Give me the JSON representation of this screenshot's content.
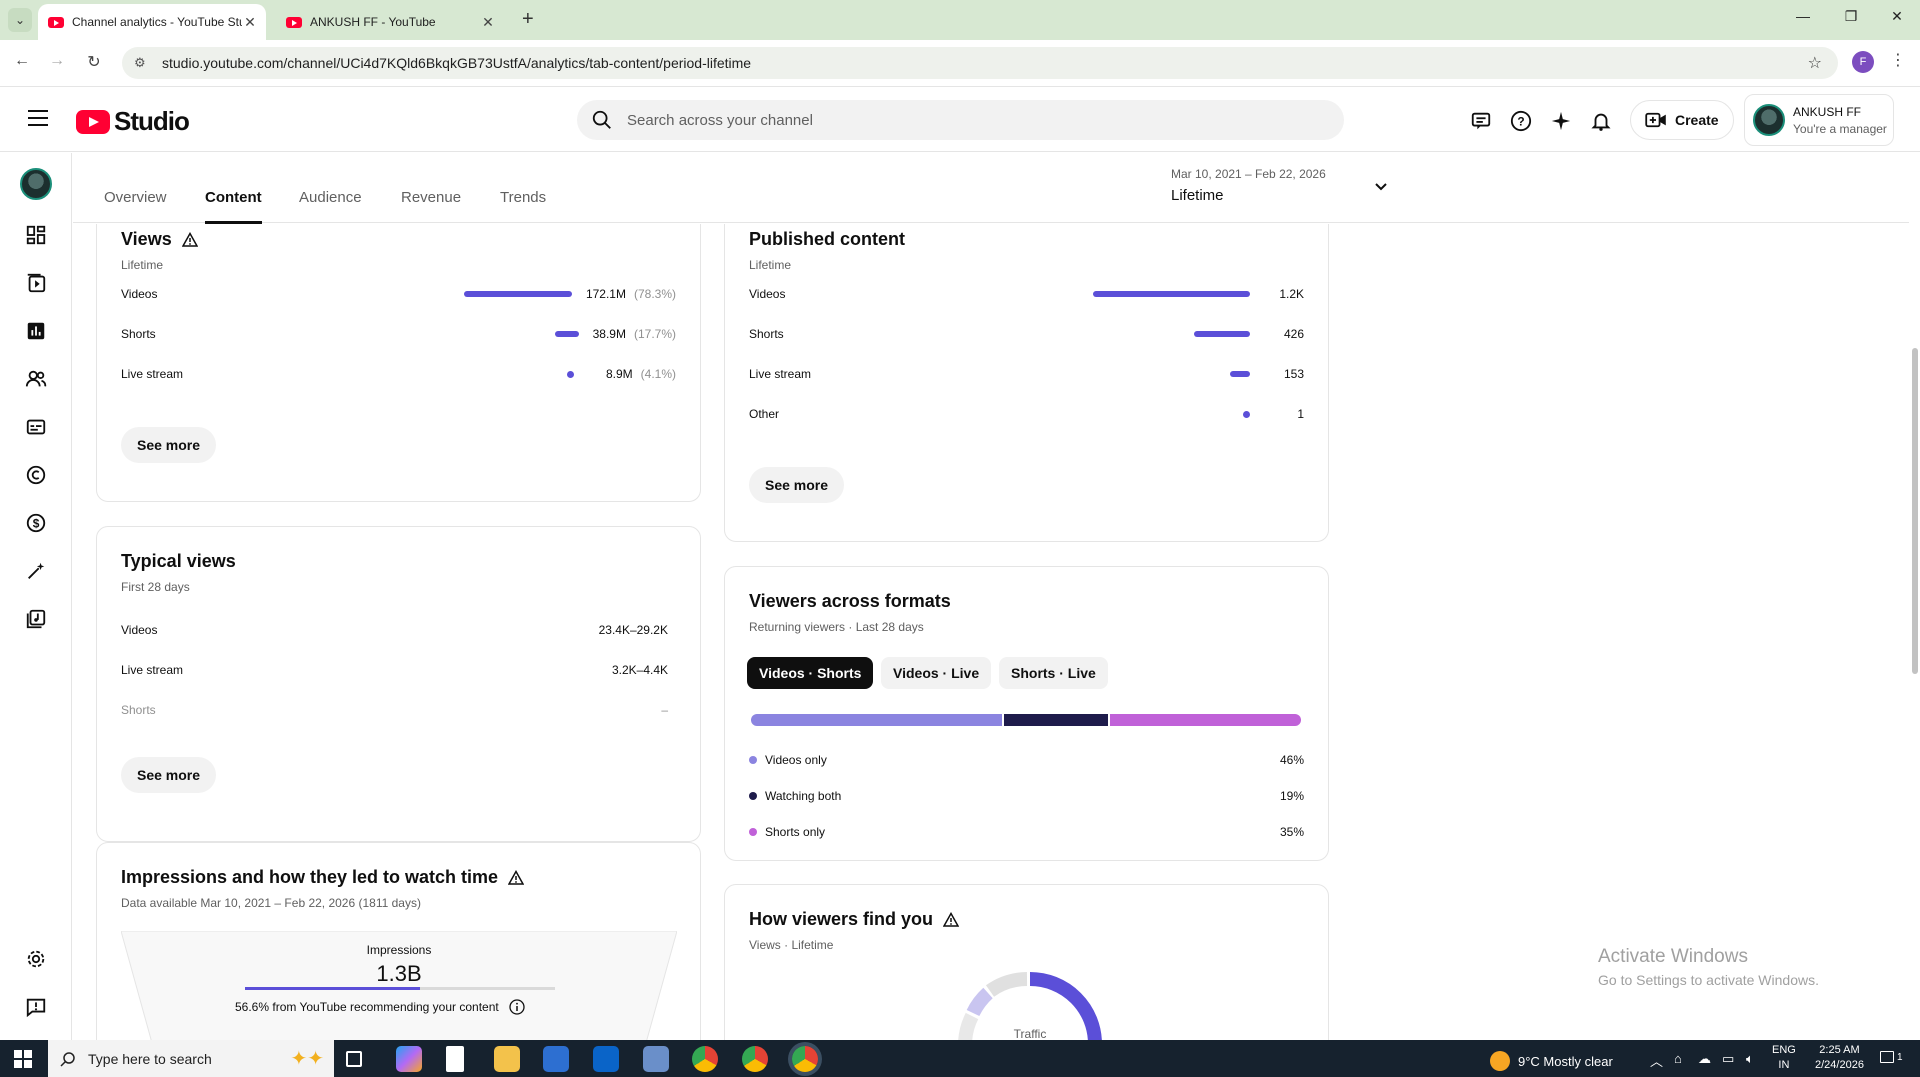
{
  "browser": {
    "tabs": [
      {
        "title": "Channel analytics - YouTube Studio",
        "active": true
      },
      {
        "title": "ANKUSH FF - YouTube",
        "active": false
      }
    ],
    "url": "studio.youtube.com/channel/UCi4d7KQld6BkqkGB73UstfA/analytics/tab-content/period-lifetime",
    "profile_initial": "F"
  },
  "header": {
    "logo_text": "Studio",
    "search_placeholder": "Search across your channel",
    "create_label": "Create",
    "account_name": "ANKUSH FF",
    "account_role": "You're a manager"
  },
  "tabs": [
    "Overview",
    "Content",
    "Audience",
    "Revenue",
    "Trends"
  ],
  "active_tab": "Content",
  "period": {
    "range": "Mar 10, 2021 – Feb 22, 2026",
    "label": "Lifetime"
  },
  "views_card": {
    "title": "Views",
    "subtitle": "Lifetime",
    "rows": [
      {
        "label": "Videos",
        "value": "172.1M",
        "pct": "(78.3%)",
        "share": 0.783
      },
      {
        "label": "Shorts",
        "value": "38.9M",
        "pct": "(17.7%)",
        "share": 0.177
      },
      {
        "label": "Live stream",
        "value": "8.9M",
        "pct": "(4.1%)",
        "share": 0.041
      }
    ],
    "see_more": "See more"
  },
  "published_card": {
    "title": "Published content",
    "subtitle": "Lifetime",
    "rows": [
      {
        "label": "Videos",
        "value": "1.2K",
        "share": 1.0
      },
      {
        "label": "Shorts",
        "value": "426",
        "share": 0.355
      },
      {
        "label": "Live stream",
        "value": "153",
        "share": 0.1275
      },
      {
        "label": "Other",
        "value": "1",
        "share": 0.001
      }
    ],
    "see_more": "See more"
  },
  "typical_card": {
    "title": "Typical views",
    "subtitle": "First 28 days",
    "rows": [
      {
        "label": "Videos",
        "value": "23.4K–29.2K"
      },
      {
        "label": "Live stream",
        "value": "3.2K–4.4K"
      },
      {
        "label": "Shorts",
        "value": "–"
      }
    ],
    "see_more": "See more"
  },
  "formats_card": {
    "title": "Viewers across formats",
    "subtitle": "Returning viewers · Last 28 days",
    "chips": [
      "Videos · Shorts",
      "Videos · Live",
      "Shorts · Live"
    ],
    "segments": [
      {
        "label": "Videos only",
        "value": "46%",
        "share": 0.46,
        "color": "#8b84e0"
      },
      {
        "label": "Watching both",
        "value": "19%",
        "share": 0.19,
        "color": "#1e1b4b"
      },
      {
        "label": "Shorts only",
        "value": "35%",
        "share": 0.35,
        "color": "#c061d8"
      }
    ]
  },
  "impressions_card": {
    "title": "Impressions and how they led to watch time",
    "subtitle": "Data available Mar 10, 2021 – Feb 22, 2026 (1811 days)",
    "metric_label": "Impressions",
    "metric_value": "1.3B",
    "progress": 0.566,
    "note": "56.6% from YouTube recommending your content"
  },
  "find_card": {
    "title": "How viewers find you",
    "subtitle": "Views · Lifetime",
    "donut_label": "Traffic"
  },
  "watermark": {
    "line1": "Activate Windows",
    "line2": "Go to Settings to activate Windows."
  },
  "taskbar": {
    "search_placeholder": "Type here to search",
    "weather": "9°C  Mostly clear",
    "lang1": "ENG",
    "lang2": "IN",
    "time": "2:25 AM",
    "date": "2/24/2026",
    "notif_count": "1"
  },
  "colors": {
    "accent": "#5b4fd8",
    "youtube_red": "#ff0033"
  }
}
